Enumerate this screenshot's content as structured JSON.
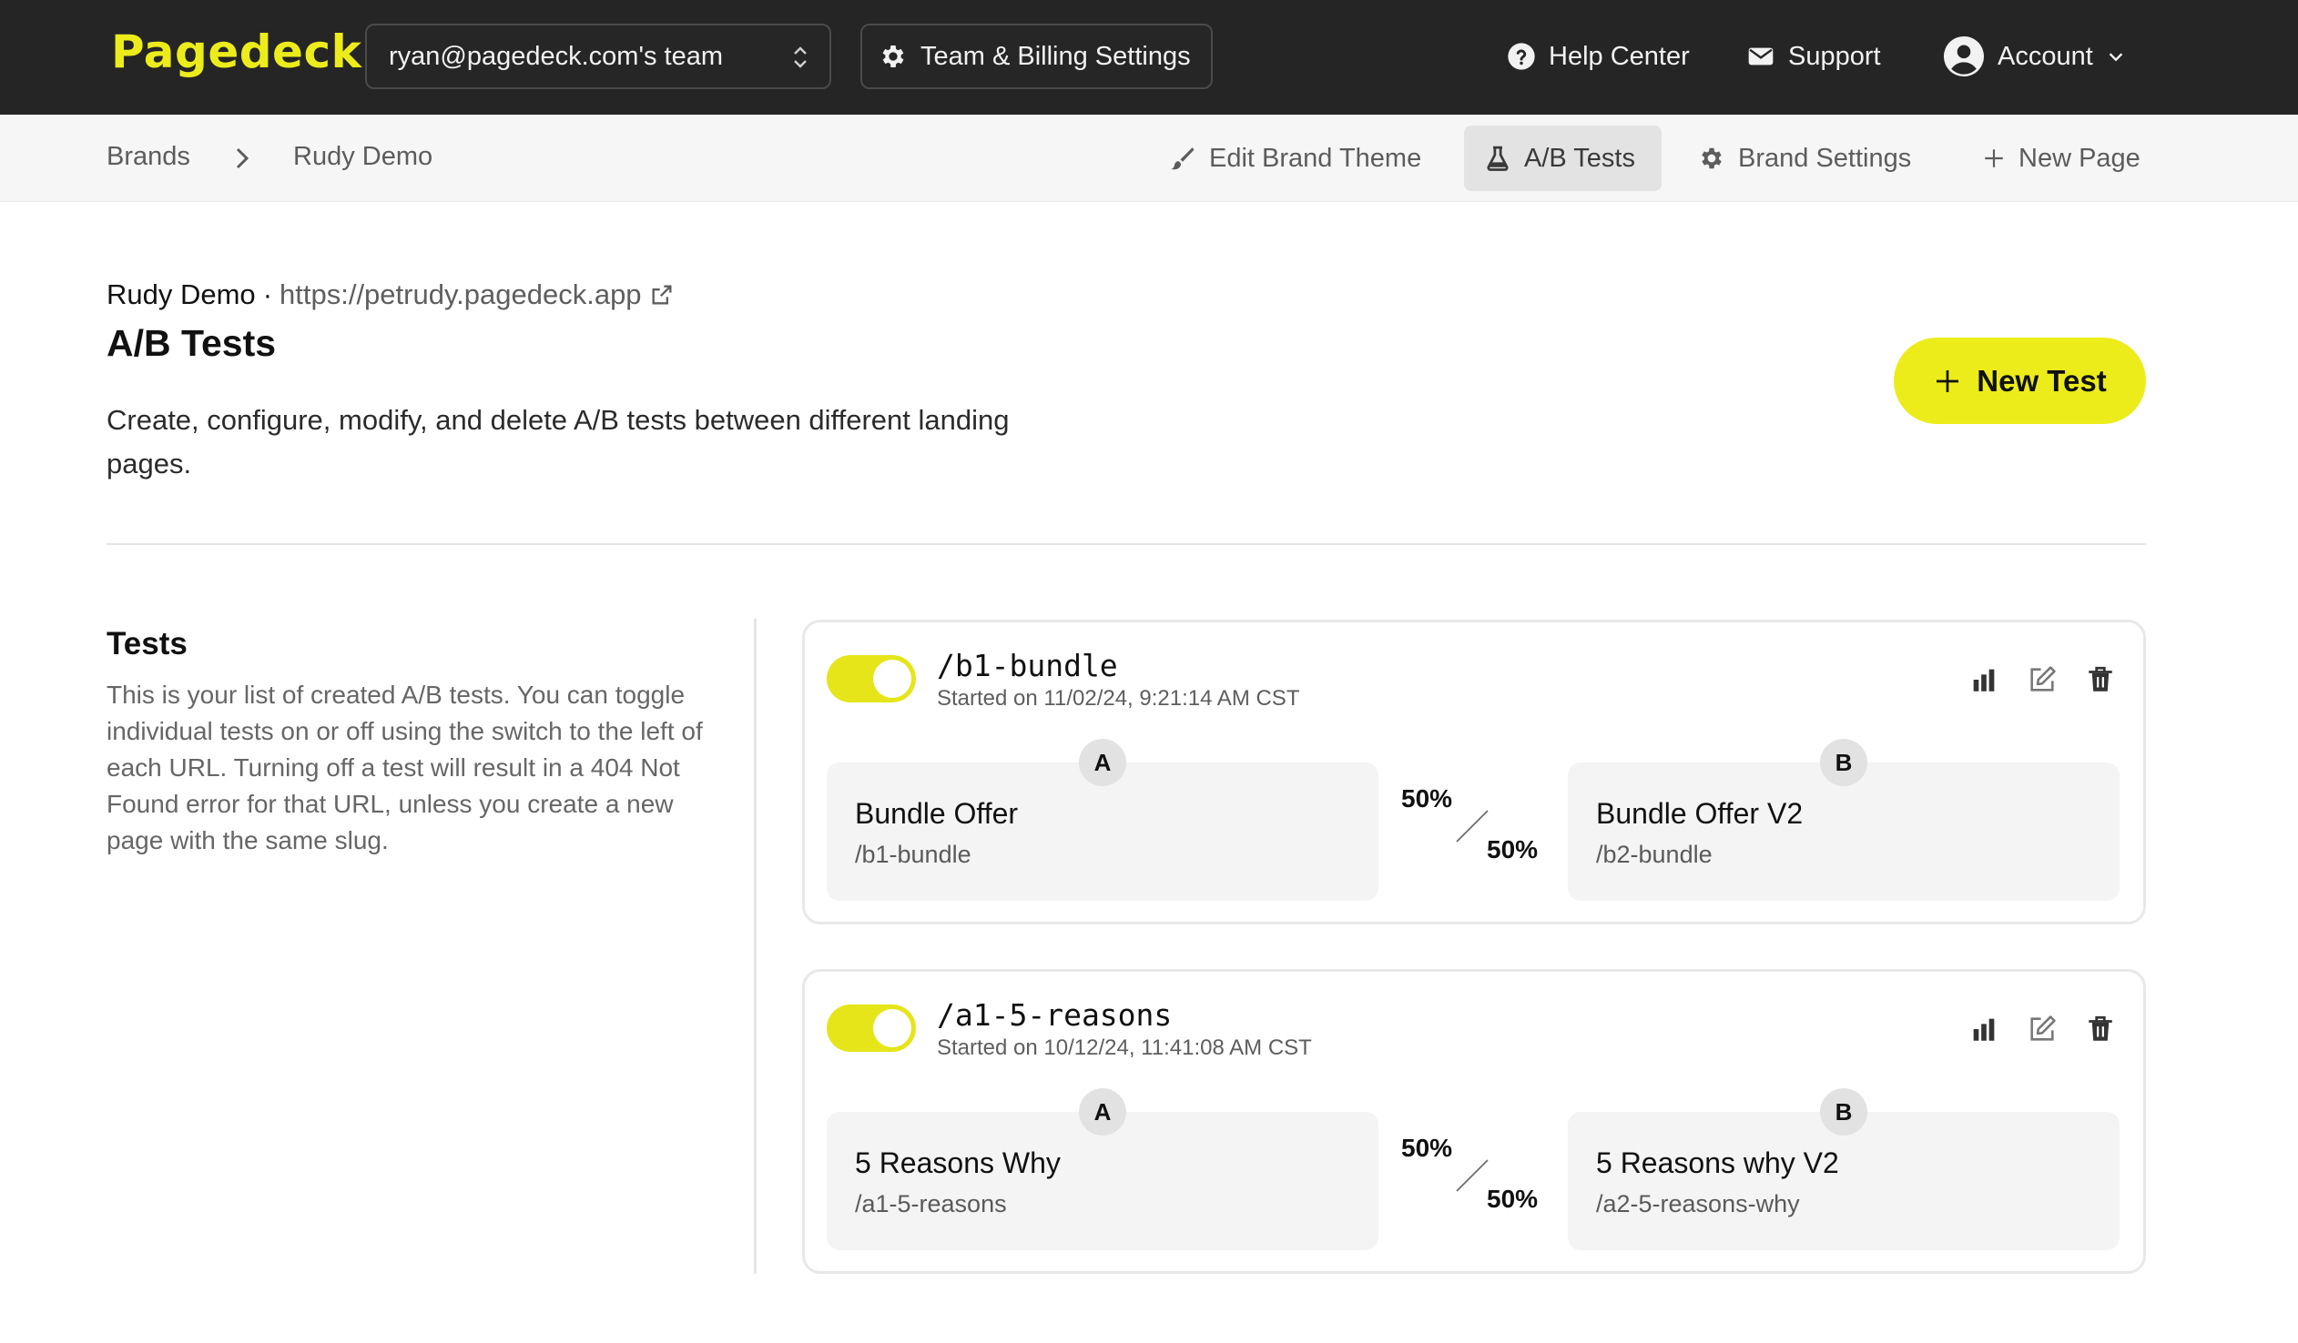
{
  "topbar": {
    "logo": "Pagedeck",
    "team_select": "ryan@pagedeck.com's team",
    "settings_label": "Team & Billing Settings",
    "help_label": "Help Center",
    "support_label": "Support",
    "account_label": "Account"
  },
  "breadcrumb": {
    "root": "Brands",
    "current": "Rudy Demo"
  },
  "subnav": {
    "edit_theme": "Edit Brand Theme",
    "ab_tests": "A/B Tests",
    "brand_settings": "Brand Settings",
    "new_page": "New Page"
  },
  "header": {
    "brand_name": "Rudy Demo",
    "separator": "·",
    "brand_url": "https://petrudy.pagedeck.app",
    "title": "A/B Tests",
    "description": "Create, configure, modify, and delete A/B tests between different landing pages.",
    "new_test_label": "New Test"
  },
  "tests_section": {
    "title": "Tests",
    "description": "This is your list of created A/B tests. You can toggle individual tests on or off using the switch to the left of each URL. Turning off a test will result in a 404 Not Found error for that URL, unless you create a new page with the same slug."
  },
  "tests": [
    {
      "slug": "/b1-bundle",
      "enabled": true,
      "started": "Started on 11/02/24, 9:21:14 AM CST",
      "variant_a": {
        "badge": "A",
        "name": "Bundle Offer",
        "path": "/b1-bundle"
      },
      "variant_b": {
        "badge": "B",
        "name": "Bundle Offer V2",
        "path": "/b2-bundle"
      },
      "split_a": "50%",
      "split_b": "50%"
    },
    {
      "slug": "/a1-5-reasons",
      "enabled": true,
      "started": "Started on 10/12/24, 11:41:08 AM CST",
      "variant_a": {
        "badge": "A",
        "name": "5 Reasons Why",
        "path": "/a1-5-reasons"
      },
      "variant_b": {
        "badge": "B",
        "name": "5 Reasons why V2",
        "path": "/a2-5-reasons-why"
      },
      "split_a": "50%",
      "split_b": "50%"
    }
  ],
  "colors": {
    "accent": "#ecec1b",
    "topbar_bg": "#252525",
    "subnav_bg": "#f6f6f6"
  }
}
